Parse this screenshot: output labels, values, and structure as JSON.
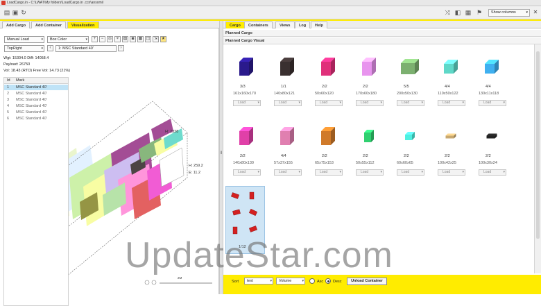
{
  "window": {
    "title": "LoadCargo.in - C:\\LWAT\\My folders\\LoadCargo.in .ccn\\ansomil"
  },
  "toolbar": {
    "show_columns": "Show columns"
  },
  "left_tabs": [
    "Add Cargo",
    "Add Container",
    "Visualization"
  ],
  "left_controls": {
    "manual_load": "Manual Load",
    "box_color": "Box Color",
    "view": "TopRight",
    "container": "1: MSC Standard 40'"
  },
  "stats": {
    "weight_line": "Wgt: 15304.0 Diff: 14058.4",
    "payload_line": "Payload: 26750",
    "volume_line": "Vol: 18.43 (RTO) Free Vol: 14.73 (21%)"
  },
  "container_grid": {
    "headers": [
      "Id",
      "Mark"
    ],
    "rows": [
      {
        "id": "1",
        "mark": "MSC Standard 40'",
        "selected": true
      },
      {
        "id": "2",
        "mark": "MSC Standard 40'",
        "selected": false
      },
      {
        "id": "3",
        "mark": "MSC Standard 40'",
        "selected": false
      },
      {
        "id": "4",
        "mark": "MSC Standard 40'",
        "selected": false
      },
      {
        "id": "5",
        "mark": "MSC Standard 40'",
        "selected": false
      },
      {
        "id": "6",
        "mark": "MSC Standard 40'",
        "selected": false
      }
    ]
  },
  "viz_labels": {
    "top_dim": "H: 2328",
    "side_h": "H: 259.2",
    "side_e": "E: 11.2",
    "scale": "2M"
  },
  "right_tabs": [
    "Cargo",
    "Containers",
    "Views",
    "Log",
    "Help"
  ],
  "sections": {
    "planned_cargo": "Planned Cargo",
    "planned_cargo_visual": "Planned Cargo Visual"
  },
  "cargo_cards": [
    {
      "color": "#2a1a8c",
      "count": "3/3",
      "dims": "161x160x170",
      "load": "Load",
      "shape": "tall"
    },
    {
      "color": "#3a3030",
      "count": "1/1",
      "dims": "140x80x121",
      "load": "Load",
      "shape": "tall"
    },
    {
      "color": "#e0307a",
      "count": "2/2",
      "dims": "50x60x120",
      "load": "Load",
      "shape": "tall"
    },
    {
      "color": "#e894ee",
      "count": "2/2",
      "dims": "170x60x180",
      "load": "Load",
      "shape": "tall"
    },
    {
      "color": "#7cb070",
      "count": "5/5",
      "dims": "200x50x130",
      "load": "Load",
      "shape": "long"
    },
    {
      "color": "#5fd8c8",
      "count": "4/4",
      "dims": "110x50x122",
      "load": "Load",
      "shape": "cube"
    },
    {
      "color": "#3fb0f0",
      "count": "4/4",
      "dims": "130x11x118",
      "load": "Load",
      "shape": "cube"
    },
    {
      "color": "#e040a8",
      "count": "2/2",
      "dims": "140x80x130",
      "load": "Load",
      "shape": "tall"
    },
    {
      "color": "#e07fb0",
      "count": "4/4",
      "dims": "57x37x155",
      "load": "Load",
      "shape": "tall"
    },
    {
      "color": "#d07a2a",
      "count": "2/2",
      "dims": "65x75x153",
      "load": "Load",
      "shape": "tall"
    },
    {
      "color": "#30d070",
      "count": "2/2",
      "dims": "50x55x112",
      "load": "Load",
      "shape": "small"
    },
    {
      "color": "#4ff0e0",
      "count": "2/2",
      "dims": "60x60x65",
      "load": "Load",
      "shape": "flat"
    },
    {
      "color": "#c8a870",
      "count": "2/2",
      "dims": "100x42x25",
      "load": "Load",
      "shape": "stick"
    },
    {
      "color": "#222222",
      "count": "2/2",
      "dims": "100x30x24",
      "load": "Load",
      "shape": "stick"
    }
  ],
  "selected_card": {
    "count": "1/12",
    "color": "#d42020"
  },
  "bottom": {
    "sort_label": "Sort",
    "sort_value": "text",
    "volume_value": "Volume",
    "asc_label": "Asc",
    "desc_label": "Desc",
    "unload_label": "Unload Container"
  },
  "watermark": "UpdateStar.com"
}
